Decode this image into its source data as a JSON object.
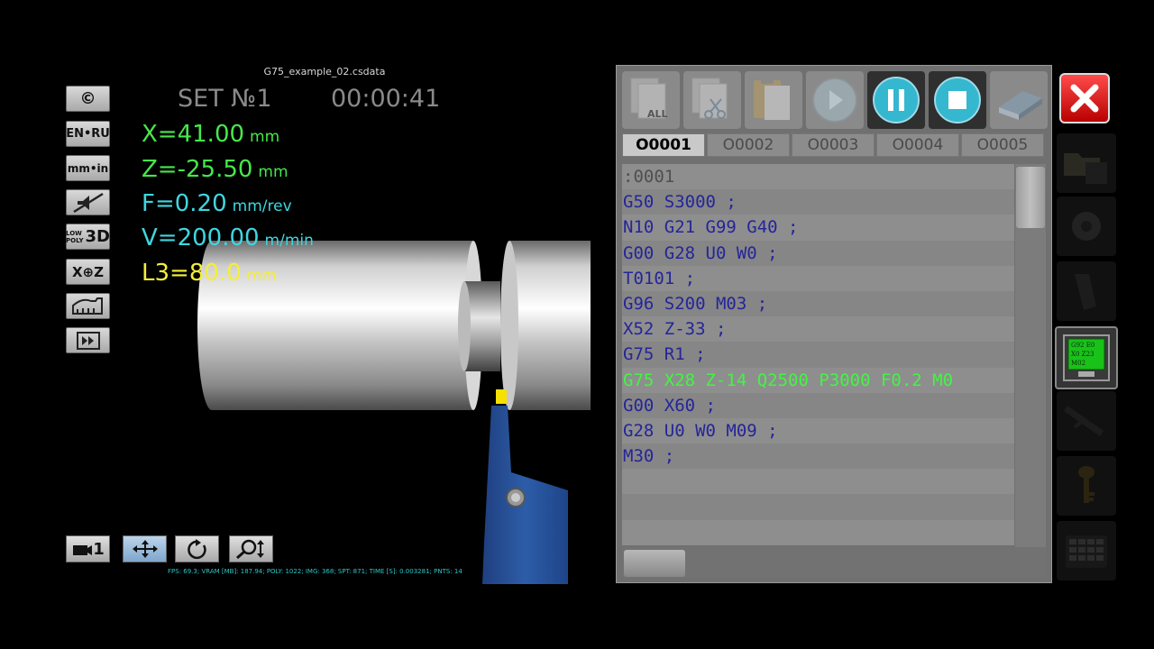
{
  "file_name": "G75_example_02.csdata",
  "set_label": "SET №1",
  "timer": "00:00:41",
  "left_buttons": {
    "copyright": "©",
    "language": "EN•RU",
    "units": "mm•in",
    "poly_top": "LOW",
    "poly_bottom": "POLY",
    "poly_3d": "3D",
    "axes": "X⊕Z"
  },
  "readouts": {
    "x": {
      "text": "X=41.00",
      "unit": "mm"
    },
    "z": {
      "text": "Z=-25.50",
      "unit": "mm"
    },
    "f": {
      "text": "F=0.20",
      "unit": "mm/rev"
    },
    "v": {
      "text": "V=200.00",
      "unit": "m/min"
    },
    "l3": {
      "text": "L3=80.0",
      "unit": "mm"
    }
  },
  "bottom_controls": {
    "camera_label": "1"
  },
  "stats": "FPS: 69.3; VRAM [MB]: 187.94; POLY: 1022; IMG: 368; SPT: 871; TIME [S]: 0.003281; PNTS: 14",
  "toolbar": {
    "all_label": "ALL"
  },
  "tabs": [
    "O0001",
    "O0002",
    "O0003",
    "O0004",
    "O0005"
  ],
  "program_lines": [
    ":0001",
    "G50 S3000 ;",
    "N10 G21 G99 G40 ;",
    "G00 G28 U0 W0 ;",
    "T0101 ;",
    "G96 S200 M03 ;",
    "X52 Z-33 ;",
    "G75 R1 ;",
    "G75 X28 Z-14 Q2500 P3000 F0.2 M0",
    "G00 X60 ;",
    "G28 U0 W0 M09 ;",
    "M30 ;",
    "",
    "",
    ""
  ],
  "editor_icon": {
    "line1": "G92 E0",
    "line2": "X0 Z23",
    "line3": "M02"
  },
  "colors": {
    "coord_green": "#45e84a",
    "coord_cyan": "#3fd6e0",
    "coord_yellow": "#f4ee3a",
    "code_blue": "#25259a",
    "current_line": "#44f344",
    "close_red": "#d40000"
  }
}
